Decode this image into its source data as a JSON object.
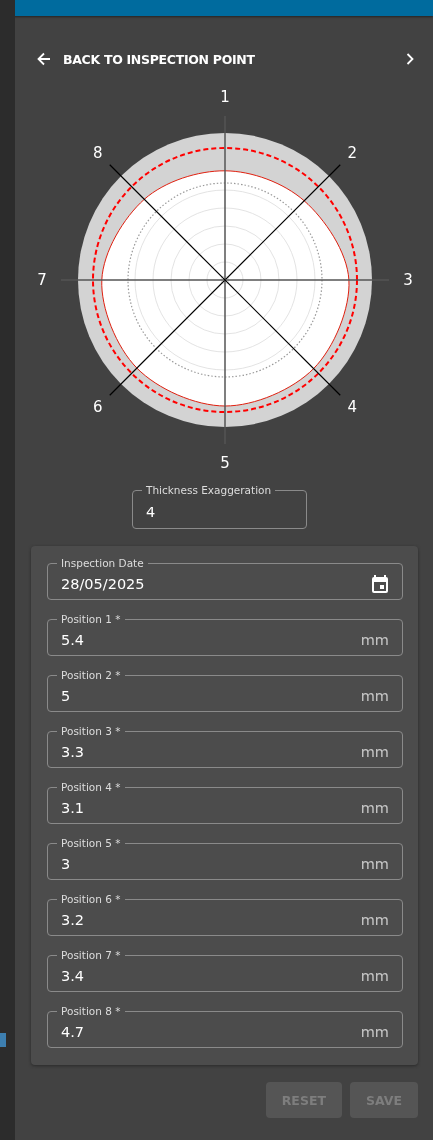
{
  "header": {
    "back_label": "BACK TO INSPECTION POINT"
  },
  "diagram": {
    "axis_labels": [
      "1",
      "2",
      "3",
      "4",
      "5",
      "6",
      "7",
      "8"
    ]
  },
  "exaggeration": {
    "label": "Thickness Exaggeration",
    "value": "4"
  },
  "inspection_date": {
    "label": "Inspection Date",
    "value": "28/05/2025"
  },
  "positions": [
    {
      "label": "Position 1 *",
      "value": "5.4",
      "unit": "mm"
    },
    {
      "label": "Position 2 *",
      "value": "5",
      "unit": "mm"
    },
    {
      "label": "Position 3 *",
      "value": "3.3",
      "unit": "mm"
    },
    {
      "label": "Position 4 *",
      "value": "3.1",
      "unit": "mm"
    },
    {
      "label": "Position 5 *",
      "value": "3",
      "unit": "mm"
    },
    {
      "label": "Position 6 *",
      "value": "3.2",
      "unit": "mm"
    },
    {
      "label": "Position 7 *",
      "value": "3.4",
      "unit": "mm"
    },
    {
      "label": "Position 8 *",
      "value": "4.7",
      "unit": "mm"
    }
  ],
  "buttons": [
    {
      "label": "RESET",
      "disabled": true
    },
    {
      "label": "SAVE",
      "disabled": true
    }
  ]
}
